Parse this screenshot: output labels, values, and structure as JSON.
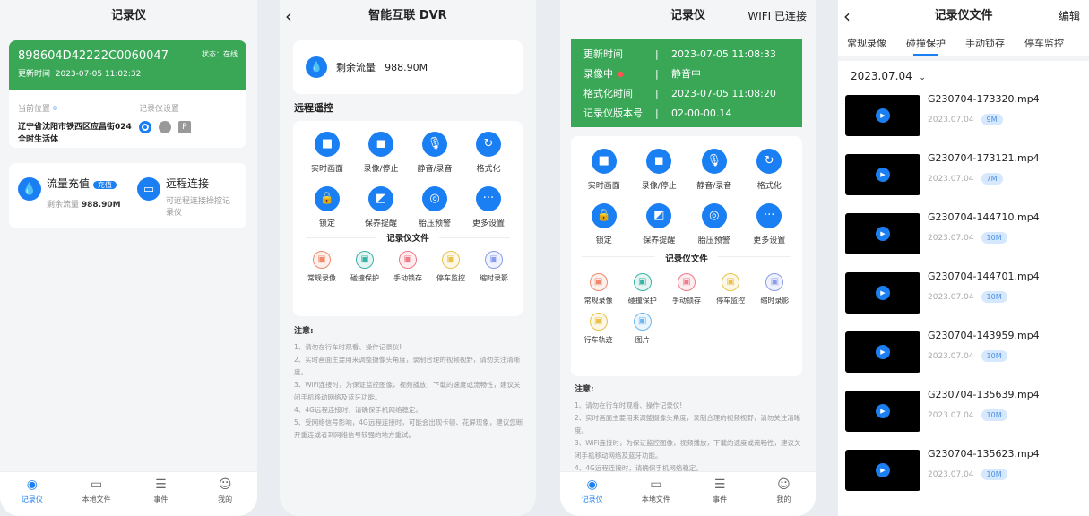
{
  "colors": {
    "accent": "#1a7ff2",
    "green": "#3aa757"
  },
  "screen1": {
    "title": "记录仪",
    "device_id": "898604D42222C0060047",
    "status": "状态：在线",
    "update_label": "更新时间",
    "update_time": "2023-07-05 11:02:32",
    "location_label": "当前位置",
    "location": "辽宁省沈阳市铁西区应昌街024全时生活体",
    "settings_label": "记录仪设置",
    "recharge_title": "流量充值",
    "recharge_button": "充值",
    "remaining_label": "剩余流量",
    "remaining_value": "988.90M",
    "remote_title": "远程连接",
    "remote_desc": "可远程连接操控记录仪"
  },
  "nav": [
    {
      "label": "记录仪",
      "icon": "recorder-icon"
    },
    {
      "label": "本地文件",
      "icon": "folder-icon"
    },
    {
      "label": "事件",
      "icon": "list-icon"
    },
    {
      "label": "我的",
      "icon": "smiley-icon"
    }
  ],
  "controls": [
    {
      "label": "实时画面",
      "icon": "video-icon"
    },
    {
      "label": "录像/停止",
      "icon": "stop-icon"
    },
    {
      "label": "静音/录音",
      "icon": "mic-icon"
    },
    {
      "label": "格式化",
      "icon": "refresh-icon"
    },
    {
      "label": "锁定",
      "icon": "lock-icon"
    },
    {
      "label": "保养提醒",
      "icon": "maintenance-icon"
    },
    {
      "label": "胎压预警",
      "icon": "tire-icon"
    },
    {
      "label": "更多设置",
      "icon": "more-icon"
    }
  ],
  "file_section": "记录仪文件",
  "file_types": [
    {
      "label": "常规录像",
      "color": "#f08a6c"
    },
    {
      "label": "碰撞保护",
      "color": "#3ab3a6"
    },
    {
      "label": "手动锁存",
      "color": "#ef7a8a"
    },
    {
      "label": "停车监控",
      "color": "#e8c24a"
    },
    {
      "label": "缩时录影",
      "color": "#8a9de8"
    },
    {
      "label": "行车轨迹",
      "color": "#e8c24a"
    },
    {
      "label": "图片",
      "color": "#6cb7f0"
    }
  ],
  "notes": {
    "title": "注意:",
    "items": [
      "1、请勿在行车时观看、操作记录仪!",
      "2、实时画面主要用来调整摄像头角度，录制合理的视频视野，请勿关注清晰度。",
      "3、WiFi连接时，为保证监控图像，视频播放，下载的速度或流畅性，建议关闭手机移动网络及蓝牙功能。",
      "4、4G远程连接时，请确保手机网络稳定。",
      "5、受网络信号影响，4G远程连接时，可能会出现卡顿、花屏现象，建议您断开重连或者到网络信号较强的地方重试。"
    ]
  },
  "screen2": {
    "title": "智能互联 DVR",
    "remaining_label": "剩余流量",
    "remaining_value": "988.90M",
    "remote_section": "远程遥控"
  },
  "screen3": {
    "title": "记录仪",
    "wifi_status": "WIFI 已连接",
    "rows": [
      {
        "k": "更新时间",
        "v": "2023-07-05 11:08:33"
      },
      {
        "k": "录像中",
        "v": "静音中"
      },
      {
        "k": "格式化时间",
        "v": "2023-07-05 11:08:20"
      },
      {
        "k": "记录仪版本号",
        "v": "02-00-00.14"
      }
    ]
  },
  "screen4": {
    "title": "记录仪文件",
    "edit": "编辑",
    "tabs": [
      "常规录像",
      "碰撞保护",
      "手动锁存",
      "停车监控"
    ],
    "active_tab": "碰撞保护",
    "date": "2023.07.04",
    "videos": [
      {
        "name": "G230704-173320.mp4",
        "date": "2023.07.04",
        "size": "9M"
      },
      {
        "name": "G230704-173121.mp4",
        "date": "2023.07.04",
        "size": "7M"
      },
      {
        "name": "G230704-144710.mp4",
        "date": "2023.07.04",
        "size": "10M"
      },
      {
        "name": "G230704-144701.mp4",
        "date": "2023.07.04",
        "size": "10M"
      },
      {
        "name": "G230704-143959.mp4",
        "date": "2023.07.04",
        "size": "10M"
      },
      {
        "name": "G230704-135639.mp4",
        "date": "2023.07.04",
        "size": "10M"
      },
      {
        "name": "G230704-135623.mp4",
        "date": "2023.07.04",
        "size": "10M"
      }
    ]
  }
}
